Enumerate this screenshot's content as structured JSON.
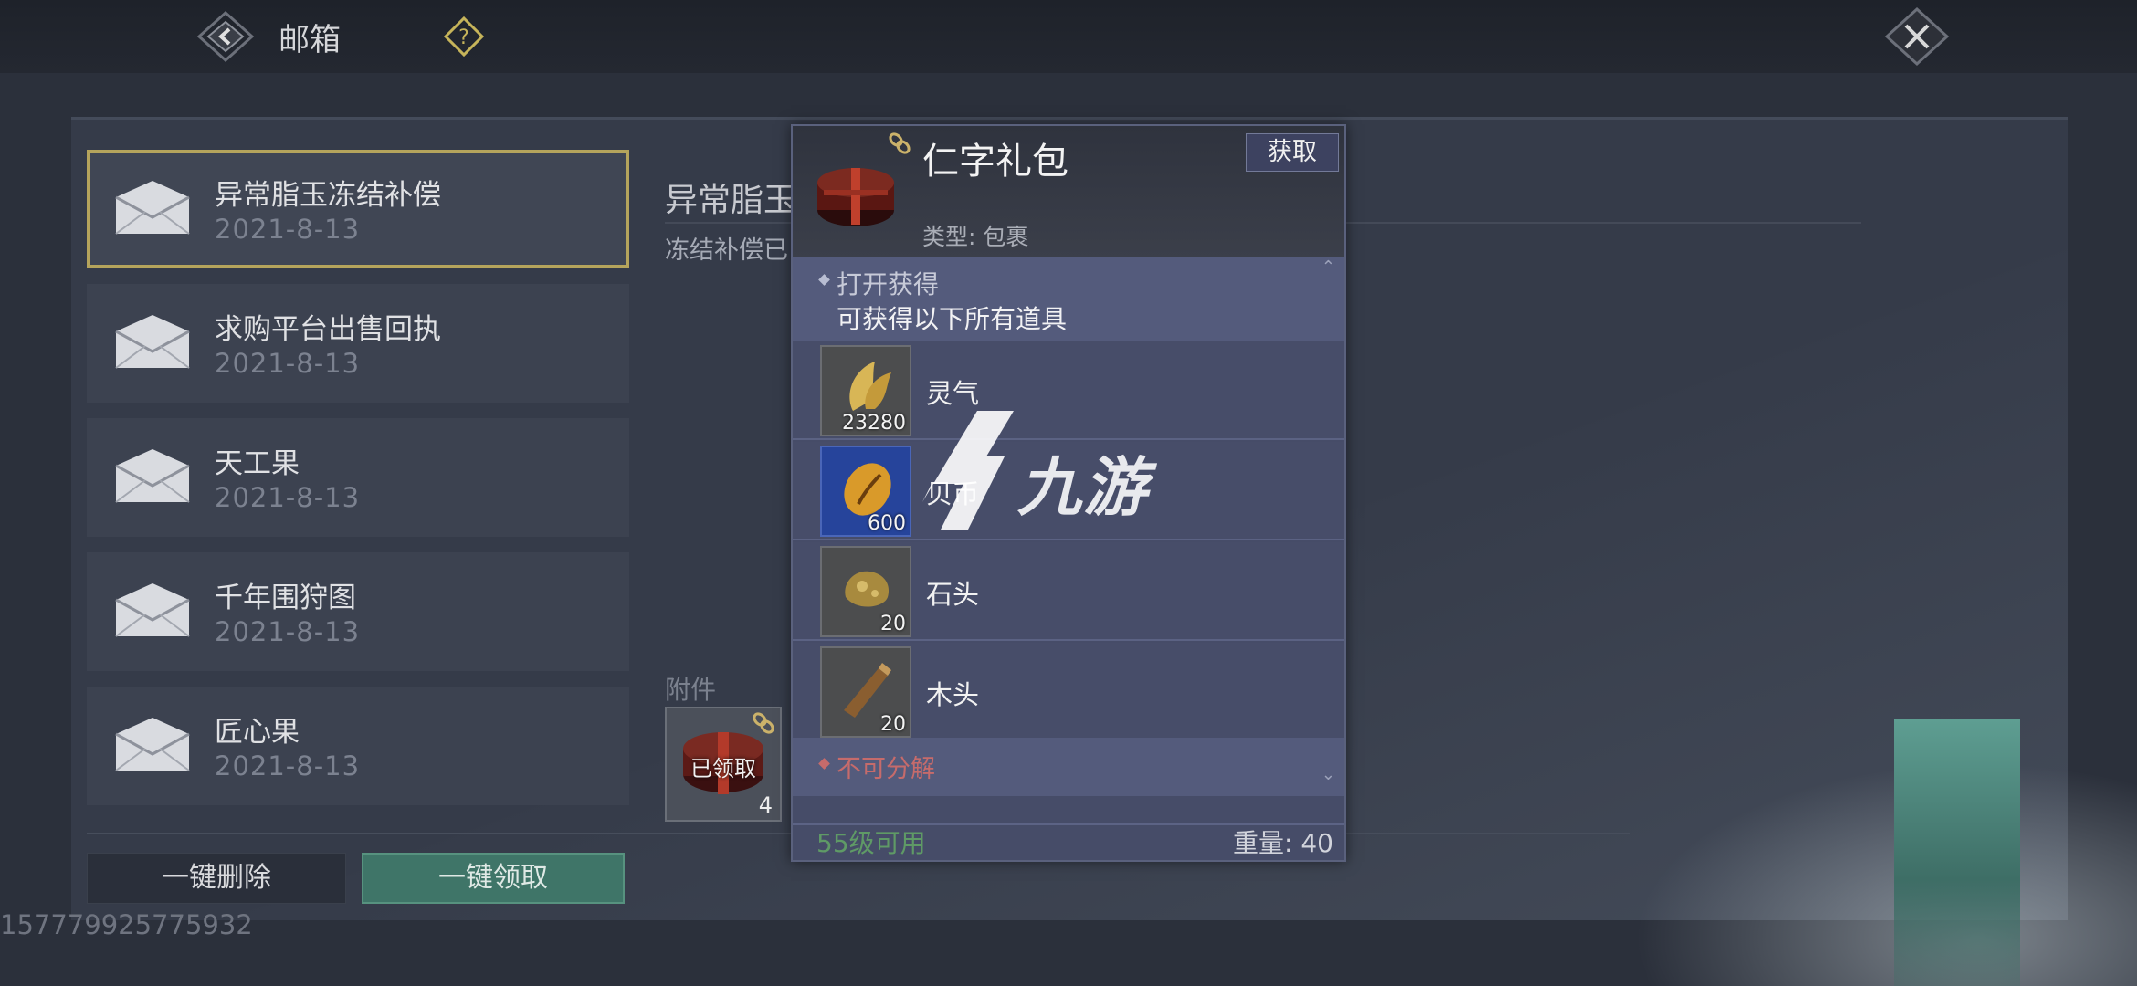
{
  "header": {
    "title": "邮箱"
  },
  "mail_list": [
    {
      "title": "异常脂玉冻结补偿",
      "date": "2021-8-13",
      "selected": true
    },
    {
      "title": "求购平台出售回执",
      "date": "2021-8-13",
      "selected": false
    },
    {
      "title": "天工果",
      "date": "2021-8-13",
      "selected": false
    },
    {
      "title": "千年围狩图",
      "date": "2021-8-13",
      "selected": false
    },
    {
      "title": "匠心果",
      "date": "2021-8-13",
      "selected": false
    }
  ],
  "detail": {
    "title": "异常脂玉",
    "body": "冻结补偿已",
    "attachment_label": "附件",
    "attachment": {
      "status": "已领取",
      "count": "4"
    }
  },
  "actions": {
    "delete_all": "一键删除",
    "claim_all": "一键领取"
  },
  "uid": "157779925775932",
  "popup": {
    "name": "仁字礼包",
    "get_button": "获取",
    "type": "类型: 包裹",
    "open_title": "打开获得",
    "open_desc": "可获得以下所有道具",
    "rewards": [
      {
        "name": "灵气",
        "count": "23280",
        "icon": "golden-feather-icon"
      },
      {
        "name": "贝币",
        "count": "600",
        "icon": "cowrie-shell-icon"
      },
      {
        "name": "石头",
        "count": "20",
        "icon": "ore-stone-icon"
      },
      {
        "name": "木头",
        "count": "20",
        "icon": "wood-log-icon"
      }
    ],
    "non_decomposable": "不可分解",
    "level_requirement": "55级可用",
    "weight": "重量: 40"
  },
  "watermark": "九游",
  "colors": {
    "selected_border": "#b5a45c",
    "claim_button": "#3f7568",
    "popup_bg": "#464c68",
    "warning_red": "#c66b6b",
    "level_green": "#5f9a66"
  }
}
